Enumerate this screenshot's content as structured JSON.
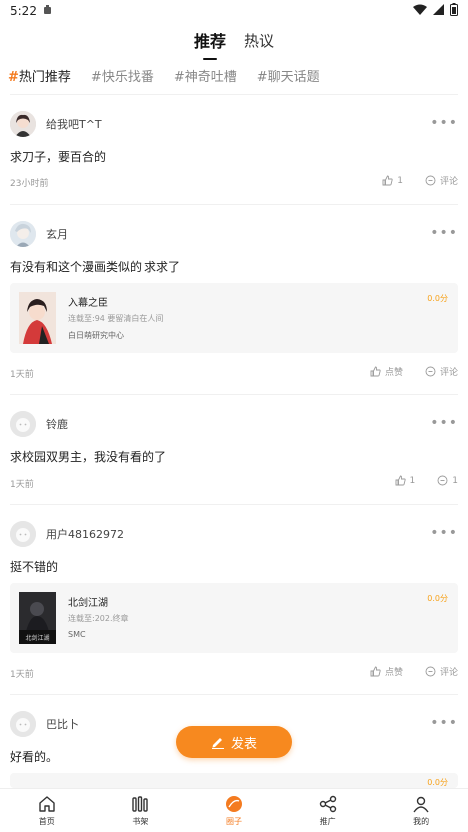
{
  "status_bar": {
    "time": "5:22"
  },
  "top_tabs": [
    {
      "label": "推荐",
      "active": true
    },
    {
      "label": "热议",
      "active": false
    }
  ],
  "topics": [
    {
      "label": "热门推荐",
      "active": true
    },
    {
      "label": "#快乐找番",
      "active": false
    },
    {
      "label": "#神奇吐槽",
      "active": false
    },
    {
      "label": "#聊天话题",
      "active": false
    }
  ],
  "posts": [
    {
      "user": "给我吧T^T",
      "text": "求刀子，要百合的",
      "time": "23小时前",
      "like": "1",
      "comment": "评论"
    },
    {
      "user": "玄月",
      "text": "有没有和这个漫画类似的 求求了",
      "time": "1天前",
      "like": "点赞",
      "comment": "评论",
      "book": {
        "title": "入幕之臣",
        "sub": "连载至:94 要留清白在人间",
        "author": "白日萌研究中心",
        "score": "0.0分"
      }
    },
    {
      "user": "铃鹿",
      "text": "求校园双男主，我没有看的了",
      "time": "1天前",
      "like": "1",
      "comment": "1"
    },
    {
      "user": "用户48162972",
      "text": "挺不错的",
      "time": "1天前",
      "like": "点赞",
      "comment": "评论",
      "book": {
        "title": "北剑江湖",
        "sub": "连载至:202.终章",
        "author": "SMC",
        "score": "0.0分",
        "cover_text": "北剑江湖"
      }
    },
    {
      "user": "巴比卜",
      "text": "好看的。",
      "partial_score": "0.0分"
    }
  ],
  "post_button": {
    "label": "发表"
  },
  "bottom_nav": [
    {
      "label": "首页",
      "icon": "home-icon",
      "active": false
    },
    {
      "label": "书架",
      "icon": "bookshelf-icon",
      "active": false
    },
    {
      "label": "圈子",
      "icon": "circle-icon",
      "active": true
    },
    {
      "label": "推广",
      "icon": "share-icon",
      "active": false
    },
    {
      "label": "我的",
      "icon": "user-icon",
      "active": false
    }
  ],
  "colors": {
    "accent": "#f47b20",
    "score": "#f7a21b",
    "button": "#f7891f"
  }
}
